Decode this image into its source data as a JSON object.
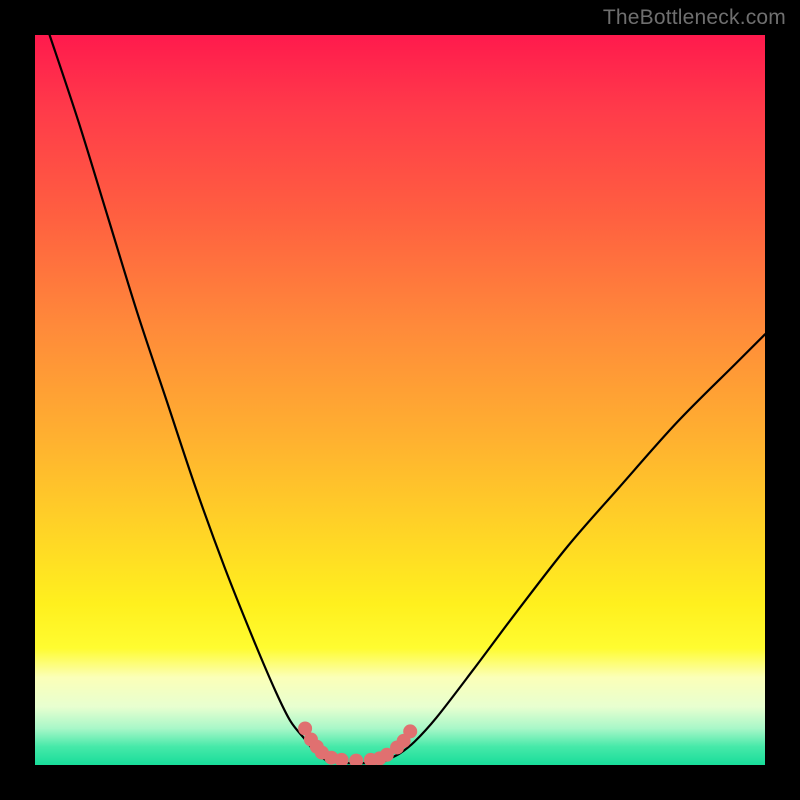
{
  "watermark": "TheBottleneck.com",
  "colors": {
    "background": "#000000",
    "curve_stroke": "#000000",
    "dot_fill": "#e07070",
    "gradient_top": "#ff1a4d",
    "gradient_bottom": "#18dd9a"
  },
  "chart_data": {
    "type": "line",
    "title": "",
    "xlabel": "",
    "ylabel": "",
    "xlim": [
      0,
      100
    ],
    "ylim": [
      0,
      100
    ],
    "grid": false,
    "series": [
      {
        "name": "curve-left",
        "x": [
          2,
          6,
          10,
          14,
          18,
          22,
          26,
          30,
          33,
          35,
          37,
          38,
          39,
          40
        ],
        "y": [
          100,
          88,
          75,
          62,
          50,
          38,
          27,
          17,
          10,
          6,
          3.5,
          2.2,
          1.2,
          0.6
        ]
      },
      {
        "name": "valley-floor",
        "x": [
          40,
          42,
          44,
          46,
          48
        ],
        "y": [
          0.6,
          0.3,
          0.25,
          0.3,
          0.6
        ]
      },
      {
        "name": "curve-right",
        "x": [
          48,
          50,
          52,
          55,
          60,
          66,
          73,
          80,
          88,
          96,
          100
        ],
        "y": [
          0.6,
          1.6,
          3.2,
          6.5,
          13,
          21,
          30,
          38,
          47,
          55,
          59
        ]
      }
    ],
    "dots": {
      "name": "markers",
      "x": [
        37.0,
        37.8,
        38.6,
        39.3,
        40.6,
        42.0,
        44.0,
        46.0,
        47.2,
        48.2,
        49.6,
        50.5,
        51.4
      ],
      "y": [
        5.0,
        3.5,
        2.5,
        1.7,
        1.0,
        0.7,
        0.6,
        0.7,
        0.9,
        1.4,
        2.4,
        3.3,
        4.6
      ]
    }
  }
}
